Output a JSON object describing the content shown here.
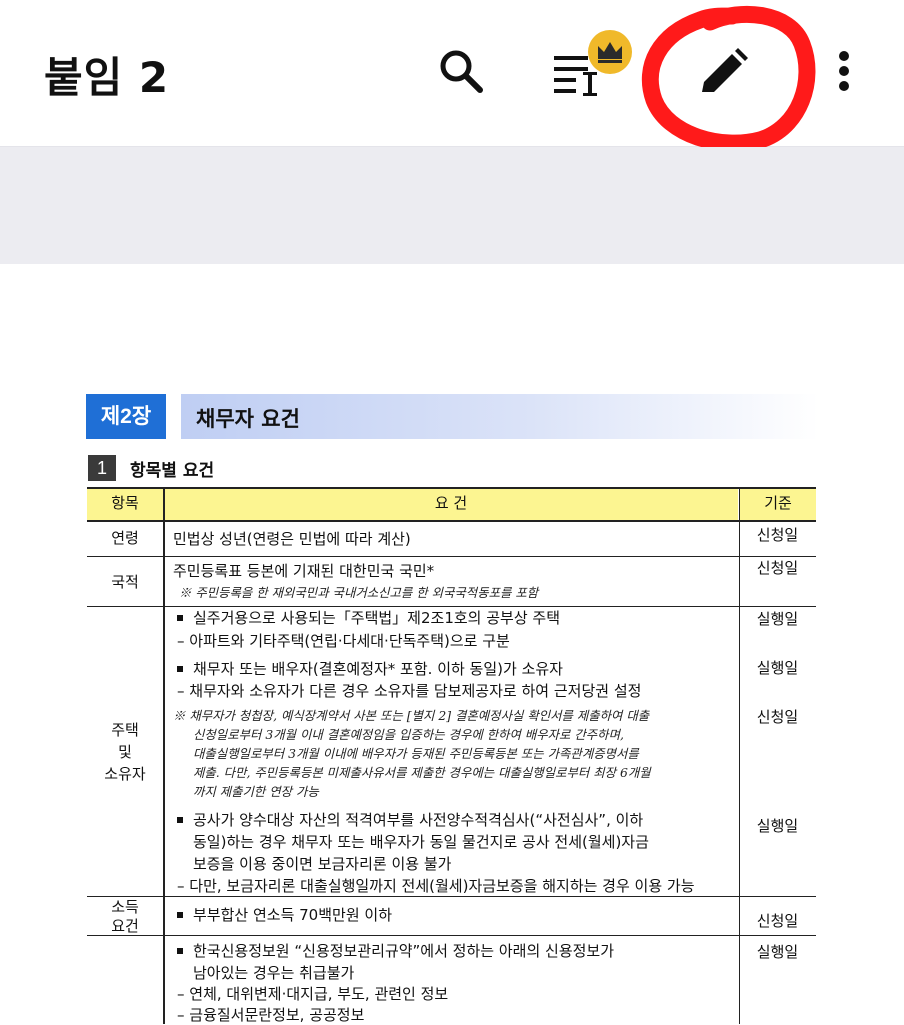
{
  "header": {
    "title": "붙임 2"
  },
  "icons": [
    "search-icon",
    "text-format-icon",
    "crown-icon",
    "pencil-icon",
    "more-vertical-icon"
  ],
  "colors": {
    "chapter_badge": "#1f6fd6",
    "table_header": "#fcf591",
    "crown_badge": "#f0b92a",
    "annotation": "#ff1a1a"
  },
  "doc": {
    "chapter_num": "제2장",
    "chapter_title": "채무자 요건",
    "section_num": "1",
    "section_title": "항목별 요건",
    "table": {
      "headers": [
        "항목",
        "요 건",
        "기준"
      ],
      "rows": {
        "age": {
          "cat": "연령",
          "req": "민법상 성년(연령은 민법에 따라 계산)",
          "std": "신청일"
        },
        "nationality": {
          "cat": "국적",
          "req": "주민등록표 등본에 기재된 대한민국 국민*",
          "note": "※ 주민등록을 한 재외국민과 국내거소신고를 한 외국국적동포를 포함",
          "std": "신청일"
        },
        "housing": {
          "cat1": "주택",
          "cat2": "및",
          "cat3": "소유자",
          "b1": "실주거용으로 사용되는「주택법」제2조1호의 공부상 주택",
          "b1_sub": "– 아파트와 기타주택(연립·다세대·단독주택)으로 구분",
          "b1_std": "실행일",
          "b2": "채무자 또는 배우자(결혼예정자* 포함. 이하 동일)가 소유자",
          "b2_sub": "– 채무자와 소유자가 다른 경우 소유자를 담보제공자로 하여 근저당권 설정",
          "b2_std": "실행일",
          "note1": "※ 채무자가 청첩장, 예식장계약서 사본 또는 [별지 2] 결혼예정사실 확인서를 제출하여 대출",
          "note2": "신청일로부터 3개월 이내 결혼예정임을 입증하는 경우에 한하여 배우자로 간주하며,",
          "note3": "대출실행일로부터 3개월 이내에 배우자가 등재된 주민등록등본 또는 가족관계증명서를",
          "note4": "제출. 다만, 주민등록등본 미제출사유서를 제출한 경우에는 대출실행일로부터 최장 6개월",
          "note5": "까지 제출기한 연장 가능",
          "note_std": "신청일",
          "b3_1": "공사가 양수대상 자산의 적격여부를 사전양수적격심사(“사전심사”, 이하",
          "b3_2": "동일)하는 경우 채무자 또는 배우자가 동일 물건지로 공사 전세(월세)자금",
          "b3_3": "보증을 이용 중이면 보금자리론 이용 불가",
          "b3_sub": "– 다만, 보금자리론 대출실행일까지 전세(월세)자금보증을 해지하는 경우 이용 가능",
          "b3_std": "실행일"
        },
        "income": {
          "cat1": "소득",
          "cat2": "요건",
          "req": "부부합산 연소득 70백만원 이하",
          "std": "신청일"
        },
        "credit": {
          "b1_1": "한국신용정보원 “신용정보관리규약”에서 정하는 아래의 신용정보가",
          "b1_2": "남아있는 경우는 취급불가",
          "sub1": "– 연체, 대위변제·대지급, 부도, 관련인 정보",
          "sub2": "– 금융질서문란정보, 공공정보",
          "std": "실행일"
        }
      }
    }
  }
}
